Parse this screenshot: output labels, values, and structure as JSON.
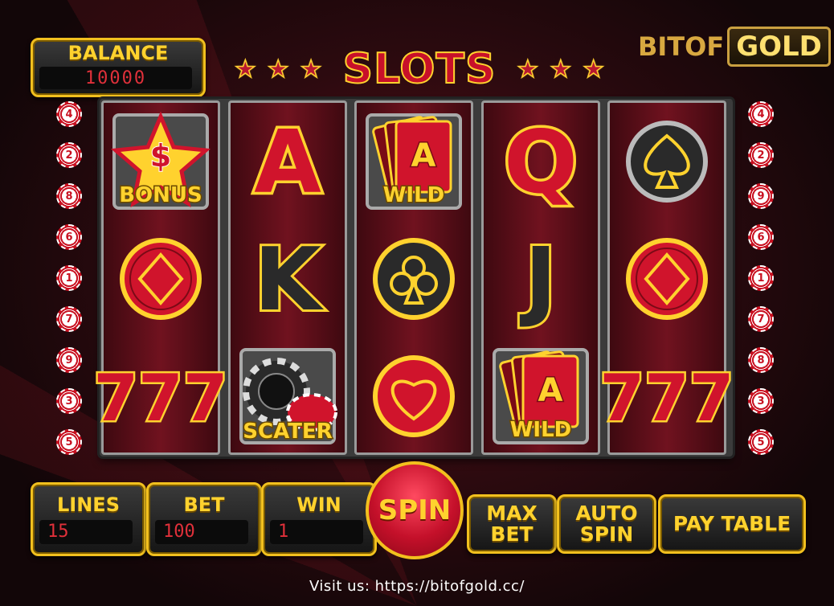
{
  "balance": {
    "label": "BALANCE",
    "value": "10000"
  },
  "title": "SLOTS",
  "logo": {
    "left": "BITOF",
    "right": "GOLD"
  },
  "chips_left": [
    "4",
    "2",
    "8",
    "6",
    "1",
    "7",
    "9",
    "3",
    "5"
  ],
  "chips_right": [
    "4",
    "2",
    "9",
    "6",
    "1",
    "7",
    "8",
    "3",
    "5"
  ],
  "reels": [
    [
      "bonus",
      "diamond",
      "seven"
    ],
    [
      "letter-A",
      "letter-K",
      "scatter"
    ],
    [
      "wild",
      "club",
      "heart"
    ],
    [
      "letter-Q",
      "letter-J",
      "wild"
    ],
    [
      "spade",
      "diamond",
      "seven"
    ]
  ],
  "symbol_labels": {
    "bonus": "BONUS",
    "wild": "WILD",
    "scatter": "SCATER",
    "A": "A",
    "K": "K",
    "Q": "Q",
    "J": "J",
    "seven": "777",
    "dollar": "$"
  },
  "lines": {
    "label": "LINES",
    "value": "15"
  },
  "bet": {
    "label": "BET",
    "value": "100"
  },
  "win": {
    "label": "WIN",
    "value": "1"
  },
  "buttons": {
    "spin": "SPIN",
    "max_bet_1": "MAX",
    "max_bet_2": "BET",
    "auto_spin_1": "AUTO",
    "auto_spin_2": "SPIN",
    "pay_table": "PAY TABLE"
  },
  "footer": "Visit us: https://bitofgold.cc/",
  "colors": {
    "gold": "#ffd22e",
    "red": "#c8102a",
    "panel": "#1a1a1a"
  }
}
